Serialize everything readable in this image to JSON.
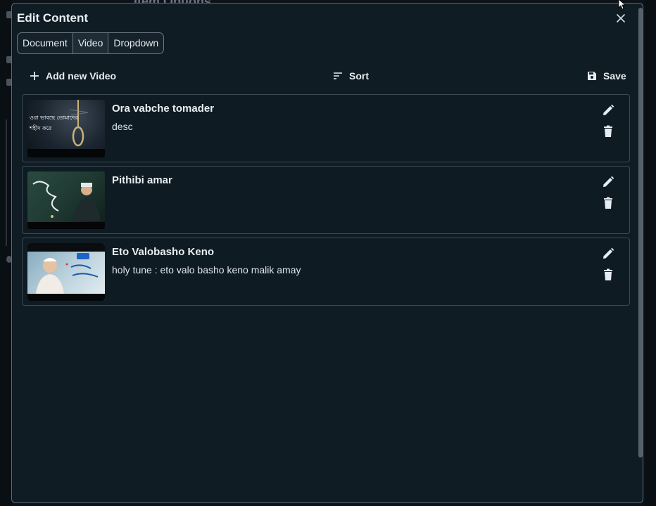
{
  "background": {
    "title": "Item Options"
  },
  "modal": {
    "title": "Edit Content",
    "close_icon": "close-icon"
  },
  "tabs": [
    {
      "label": "Document",
      "active": false
    },
    {
      "label": "Video",
      "active": true
    },
    {
      "label": "Dropdown",
      "active": false
    }
  ],
  "toolbar": {
    "add_label": "Add new Video",
    "add_icon": "plus-icon",
    "sort_label": "Sort",
    "sort_icon": "sort-icon",
    "save_label": "Save",
    "save_icon": "floppy-disk-icon"
  },
  "videos": [
    {
      "title": "Ora vabche tomader",
      "description": "desc",
      "thumbnail_text": [
        "ওরা ভাবছে তোমাদের",
        "শহীদ করে"
      ],
      "thumbnail_palette": [
        "#1b2530",
        "#3e4a56"
      ]
    },
    {
      "title": "Pithibi amar",
      "description": "",
      "thumbnail_palette": [
        "#1f3a33",
        "#4e6f5e"
      ]
    },
    {
      "title": "Eto Valobasho Keno",
      "description": "holy tune : eto valo basho keno malik amay",
      "thumbnail_palette": [
        "#8fb7c9",
        "#d9e4ea"
      ]
    }
  ],
  "colors": {
    "modal_bg": "#0f1c24",
    "border": "#5d6b75",
    "text": "#e6edf3"
  }
}
